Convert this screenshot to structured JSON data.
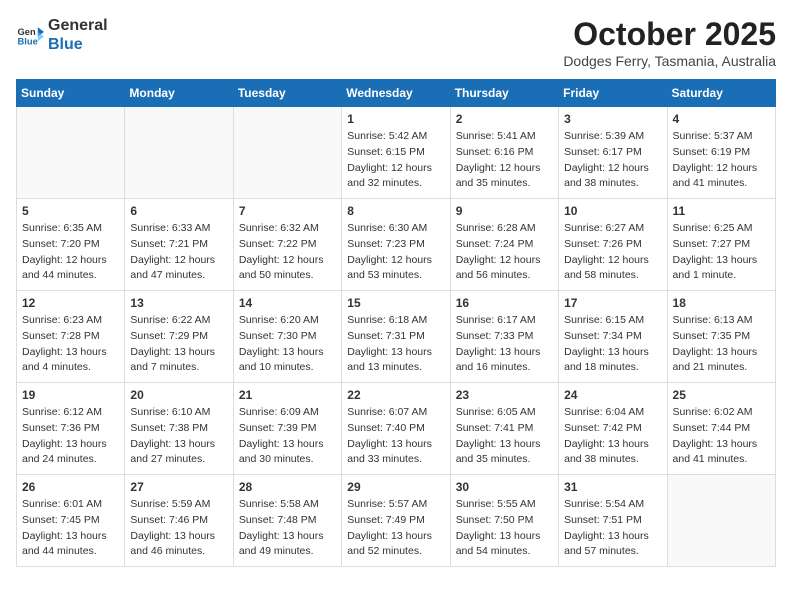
{
  "header": {
    "logo_general": "General",
    "logo_blue": "Blue",
    "title": "October 2025",
    "subtitle": "Dodges Ferry, Tasmania, Australia"
  },
  "weekdays": [
    "Sunday",
    "Monday",
    "Tuesday",
    "Wednesday",
    "Thursday",
    "Friday",
    "Saturday"
  ],
  "weeks": [
    [
      {
        "day": "",
        "info": ""
      },
      {
        "day": "",
        "info": ""
      },
      {
        "day": "",
        "info": ""
      },
      {
        "day": "1",
        "info": "Sunrise: 5:42 AM\nSunset: 6:15 PM\nDaylight: 12 hours\nand 32 minutes."
      },
      {
        "day": "2",
        "info": "Sunrise: 5:41 AM\nSunset: 6:16 PM\nDaylight: 12 hours\nand 35 minutes."
      },
      {
        "day": "3",
        "info": "Sunrise: 5:39 AM\nSunset: 6:17 PM\nDaylight: 12 hours\nand 38 minutes."
      },
      {
        "day": "4",
        "info": "Sunrise: 5:37 AM\nSunset: 6:19 PM\nDaylight: 12 hours\nand 41 minutes."
      }
    ],
    [
      {
        "day": "5",
        "info": "Sunrise: 6:35 AM\nSunset: 7:20 PM\nDaylight: 12 hours\nand 44 minutes."
      },
      {
        "day": "6",
        "info": "Sunrise: 6:33 AM\nSunset: 7:21 PM\nDaylight: 12 hours\nand 47 minutes."
      },
      {
        "day": "7",
        "info": "Sunrise: 6:32 AM\nSunset: 7:22 PM\nDaylight: 12 hours\nand 50 minutes."
      },
      {
        "day": "8",
        "info": "Sunrise: 6:30 AM\nSunset: 7:23 PM\nDaylight: 12 hours\nand 53 minutes."
      },
      {
        "day": "9",
        "info": "Sunrise: 6:28 AM\nSunset: 7:24 PM\nDaylight: 12 hours\nand 56 minutes."
      },
      {
        "day": "10",
        "info": "Sunrise: 6:27 AM\nSunset: 7:26 PM\nDaylight: 12 hours\nand 58 minutes."
      },
      {
        "day": "11",
        "info": "Sunrise: 6:25 AM\nSunset: 7:27 PM\nDaylight: 13 hours\nand 1 minute."
      }
    ],
    [
      {
        "day": "12",
        "info": "Sunrise: 6:23 AM\nSunset: 7:28 PM\nDaylight: 13 hours\nand 4 minutes."
      },
      {
        "day": "13",
        "info": "Sunrise: 6:22 AM\nSunset: 7:29 PM\nDaylight: 13 hours\nand 7 minutes."
      },
      {
        "day": "14",
        "info": "Sunrise: 6:20 AM\nSunset: 7:30 PM\nDaylight: 13 hours\nand 10 minutes."
      },
      {
        "day": "15",
        "info": "Sunrise: 6:18 AM\nSunset: 7:31 PM\nDaylight: 13 hours\nand 13 minutes."
      },
      {
        "day": "16",
        "info": "Sunrise: 6:17 AM\nSunset: 7:33 PM\nDaylight: 13 hours\nand 16 minutes."
      },
      {
        "day": "17",
        "info": "Sunrise: 6:15 AM\nSunset: 7:34 PM\nDaylight: 13 hours\nand 18 minutes."
      },
      {
        "day": "18",
        "info": "Sunrise: 6:13 AM\nSunset: 7:35 PM\nDaylight: 13 hours\nand 21 minutes."
      }
    ],
    [
      {
        "day": "19",
        "info": "Sunrise: 6:12 AM\nSunset: 7:36 PM\nDaylight: 13 hours\nand 24 minutes."
      },
      {
        "day": "20",
        "info": "Sunrise: 6:10 AM\nSunset: 7:38 PM\nDaylight: 13 hours\nand 27 minutes."
      },
      {
        "day": "21",
        "info": "Sunrise: 6:09 AM\nSunset: 7:39 PM\nDaylight: 13 hours\nand 30 minutes."
      },
      {
        "day": "22",
        "info": "Sunrise: 6:07 AM\nSunset: 7:40 PM\nDaylight: 13 hours\nand 33 minutes."
      },
      {
        "day": "23",
        "info": "Sunrise: 6:05 AM\nSunset: 7:41 PM\nDaylight: 13 hours\nand 35 minutes."
      },
      {
        "day": "24",
        "info": "Sunrise: 6:04 AM\nSunset: 7:42 PM\nDaylight: 13 hours\nand 38 minutes."
      },
      {
        "day": "25",
        "info": "Sunrise: 6:02 AM\nSunset: 7:44 PM\nDaylight: 13 hours\nand 41 minutes."
      }
    ],
    [
      {
        "day": "26",
        "info": "Sunrise: 6:01 AM\nSunset: 7:45 PM\nDaylight: 13 hours\nand 44 minutes."
      },
      {
        "day": "27",
        "info": "Sunrise: 5:59 AM\nSunset: 7:46 PM\nDaylight: 13 hours\nand 46 minutes."
      },
      {
        "day": "28",
        "info": "Sunrise: 5:58 AM\nSunset: 7:48 PM\nDaylight: 13 hours\nand 49 minutes."
      },
      {
        "day": "29",
        "info": "Sunrise: 5:57 AM\nSunset: 7:49 PM\nDaylight: 13 hours\nand 52 minutes."
      },
      {
        "day": "30",
        "info": "Sunrise: 5:55 AM\nSunset: 7:50 PM\nDaylight: 13 hours\nand 54 minutes."
      },
      {
        "day": "31",
        "info": "Sunrise: 5:54 AM\nSunset: 7:51 PM\nDaylight: 13 hours\nand 57 minutes."
      },
      {
        "day": "",
        "info": ""
      }
    ]
  ]
}
